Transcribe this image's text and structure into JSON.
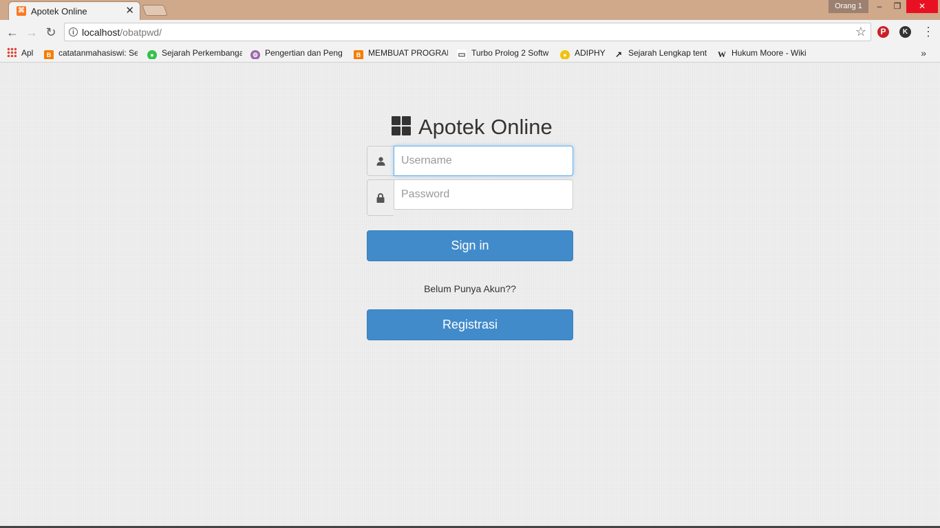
{
  "browser": {
    "tab": {
      "title": "Apotek Online"
    },
    "profile": "Orang 1",
    "url": {
      "host": "localhost",
      "path": "/obatpwd/"
    },
    "bookmarks": [
      {
        "label": "Apl",
        "icon": "apps-grid-icon"
      },
      {
        "label": "catatanmahasiswi: Se",
        "icon": "blogger-icon",
        "color": "#f57d00"
      },
      {
        "label": "Sejarah Perkembanga",
        "icon": "green-globe-icon",
        "color": "#35c24b"
      },
      {
        "label": "Pengertian dan Peng",
        "icon": "gear-site-icon",
        "color": "#9b6aa8"
      },
      {
        "label": "MEMBUAT PROGRAM",
        "icon": "blogger-icon",
        "color": "#f57d00"
      },
      {
        "label": "Turbo Prolog 2 Softw",
        "icon": "monitor-icon",
        "color": "#555555"
      },
      {
        "label": "ADIPHY",
        "icon": "yellow-circle-icon",
        "color": "#f4c20d"
      },
      {
        "label": "Sejarah Lengkap tent",
        "icon": "bird-icon",
        "color": "#222222"
      },
      {
        "label": "Hukum Moore - Wiki",
        "icon": "wikipedia-icon",
        "color": "#222222"
      }
    ]
  },
  "page": {
    "brand": "Apotek Online",
    "username_placeholder": "Username",
    "password_placeholder": "Password",
    "signin_label": "Sign in",
    "prompt": "Belum Punya Akun??",
    "register_label": "Registrasi"
  },
  "colors": {
    "primary": "#428bca",
    "tab_strip": "#d0a88a",
    "page_bg": "#efefef"
  }
}
